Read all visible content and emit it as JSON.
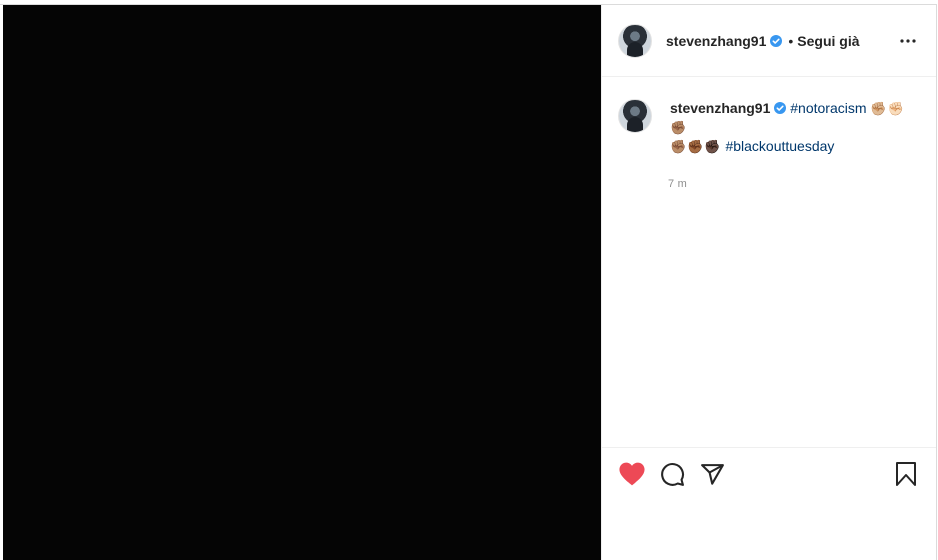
{
  "post": {
    "author": "stevenzhang91",
    "header_separator": "•",
    "follow_status": "Segui già",
    "caption": {
      "username": "stevenzhang91",
      "hashtag1": "#notoracism",
      "emoji_line1": "✊🏼✊🏻✊🏽",
      "emoji_line2": "✊🏽✊🏾✊🏿",
      "hashtag2": "#blackouttuesday"
    },
    "time_ago": "7 m",
    "liked": true
  },
  "icons": {
    "more": "more-options-icon",
    "verified": "verified-badge-icon",
    "like": "heart-icon",
    "comment": "comment-icon",
    "share": "share-icon",
    "save": "bookmark-icon"
  },
  "colors": {
    "like_red": "#ed4956",
    "verified_blue": "#3897f0",
    "hashtag_blue": "#00376b",
    "media_bg": "#050505"
  }
}
